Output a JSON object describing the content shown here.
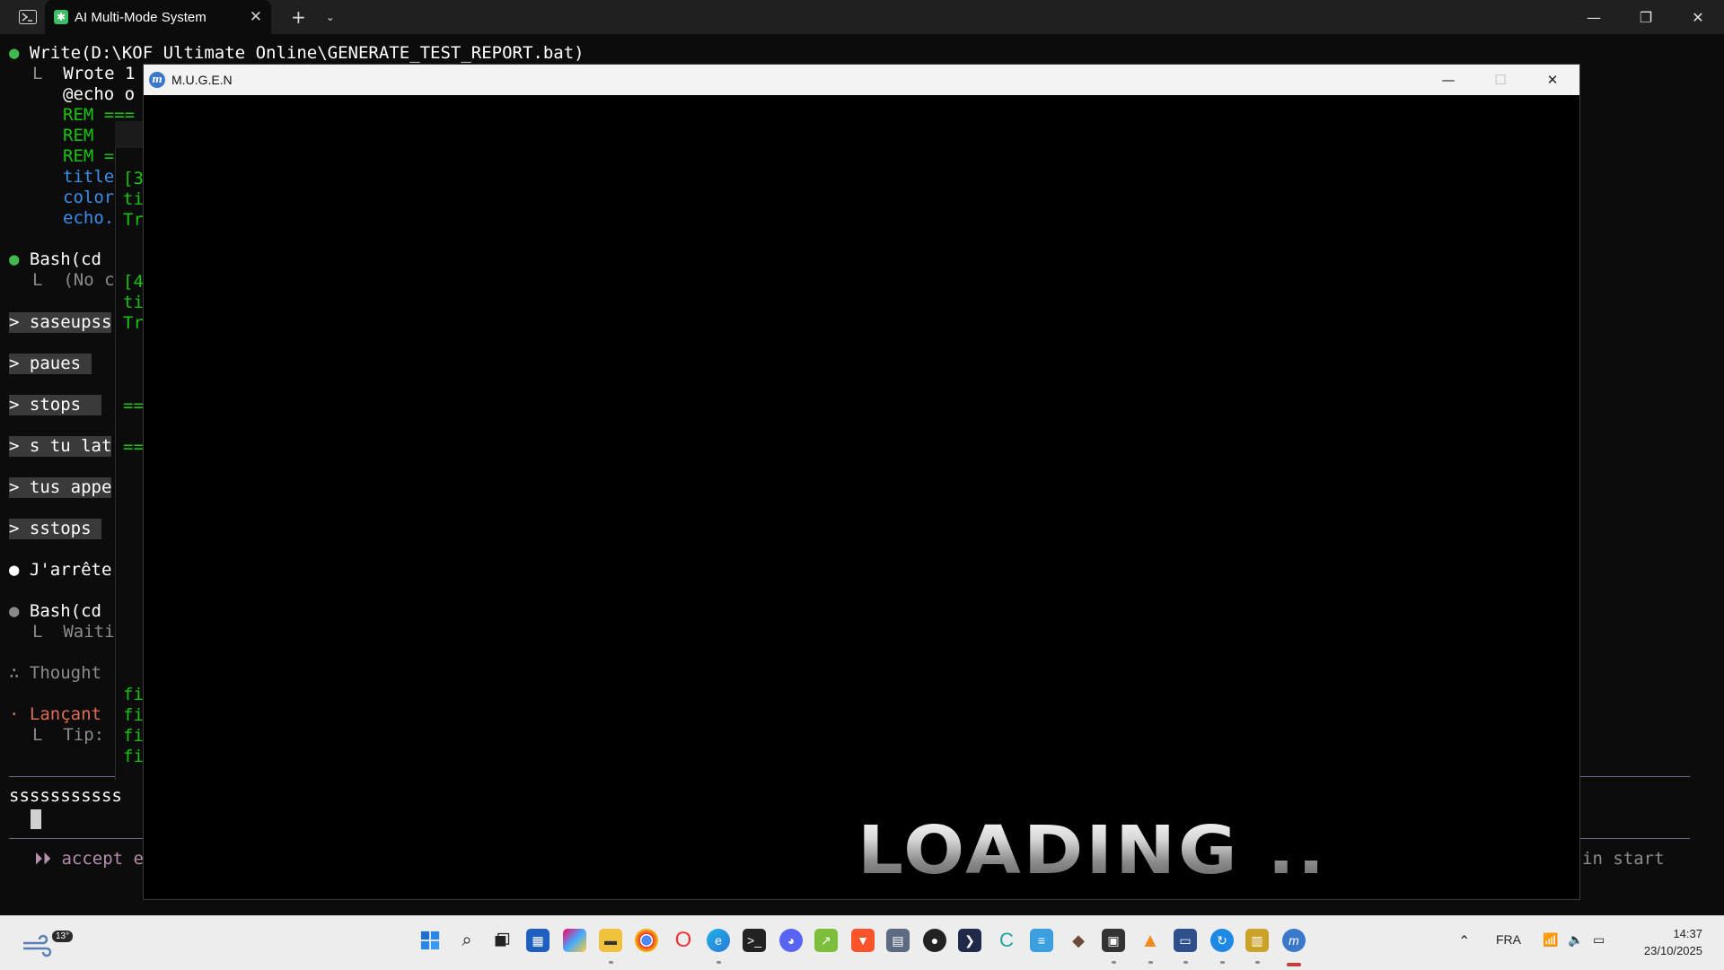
{
  "terminal": {
    "tab_title": "AI Multi-Mode System",
    "lines": {
      "write_cmd": "Write(D:\\KOF Ultimate Online\\GENERATE_TEST_REPORT.bat)",
      "wrote": "Wrote 1",
      "echo_off_a": "@echo",
      "echo_off_b": " o",
      "rem1": "REM ===",
      "rem2": "REM",
      "rem3": "REM =",
      "title": "title",
      "color": "color",
      "echo": "echo.",
      "bash1": "Bash(cd",
      "no_output": "(No c",
      "prompt1": "> saseupss",
      "prompt2": "> paues ",
      "prompt3": "> stops  ",
      "prompt4": "> s tu lat",
      "prompt5": "> tus appe",
      "prompt6": "> sstops ",
      "jarrete": "J'arrête",
      "bash2": "Bash(cd",
      "waiting": "Waiti",
      "thought": "Thought",
      "lancant": "Lançant",
      "tip": "Tip:",
      "input_text": "sssssssssss",
      "accept": "accept e",
      "in_start": "in start"
    },
    "bgwin_lines": {
      "a1": "[3",
      "a2": "ti",
      "a3": "Tr",
      "b1": "[4",
      "b2": "ti",
      "b3": "Tr",
      "eq1": "==",
      "eq2": "==",
      "f1": "fi",
      "f2": "fi",
      "f3": "fi",
      "f4": "fi"
    }
  },
  "mugen_window": {
    "title": "M.U.G.E.N",
    "loading_text": "LOADING .."
  },
  "taskbar": {
    "weather_temp": "13°",
    "language": "FRA",
    "time": "14:37",
    "date": "23/10/2025",
    "pinned_apps": [
      "start",
      "search",
      "task-view",
      "store",
      "copilot",
      "file-explorer",
      "chrome",
      "opera",
      "edge",
      "terminal",
      "discord",
      "excel-like",
      "brave",
      "calculator",
      "obs",
      "powershell",
      "app-c",
      "notepad",
      "app-bird",
      "cmd",
      "vlc",
      "app-monitor",
      "app-blue",
      "app-tiles",
      "mugen"
    ]
  }
}
